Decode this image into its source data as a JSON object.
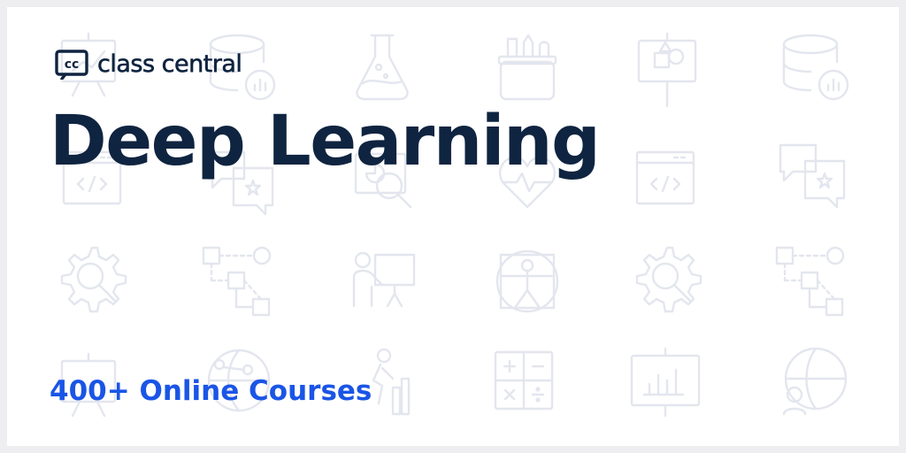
{
  "brand": {
    "mark_text": "cc",
    "name": "class central"
  },
  "headline": "Deep Learning",
  "subheadline": "400+ Online Courses",
  "colors": {
    "page_border": "#eeeef0",
    "card_background": "#ffffff",
    "headline": "#0f2440",
    "subheadline": "#1a55e6",
    "pattern_icons": "#e6e8f0"
  },
  "background_icons": [
    "easel-chart-icon",
    "database-chart-icon",
    "flask-icon",
    "pencil-cup-icon",
    "easel-shapes-icon",
    "database-chart-icon",
    "code-window-icon",
    "chat-star-icon",
    "magnifier-chart-icon",
    "heartbeat-icon",
    "code-window-icon",
    "chat-star-icon",
    "gear-search-icon",
    "flowchart-icon",
    "teacher-board-icon",
    "vitruvian-man-icon",
    "gear-search-icon",
    "flowchart-icon",
    "easel-chart-icon",
    "globe-network-icon",
    "person-growth-icon",
    "calculator-icon",
    "easel-bar-chart-icon",
    "globe-person-icon"
  ]
}
